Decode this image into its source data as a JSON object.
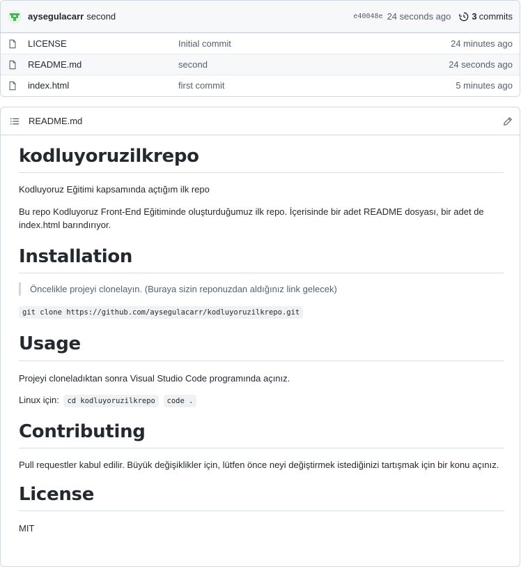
{
  "commit": {
    "author": "aysegulacarr",
    "message": "second",
    "sha": "e40048e",
    "time": "24 seconds ago",
    "count": "3",
    "count_label": "commits"
  },
  "files": [
    {
      "name": "LICENSE",
      "commit": "Initial commit",
      "age": "24 minutes ago"
    },
    {
      "name": "README.md",
      "commit": "second",
      "age": "24 seconds ago"
    },
    {
      "name": "index.html",
      "commit": "first commit",
      "age": "5 minutes ago"
    }
  ],
  "readme": {
    "filename": "README.md",
    "title": "kodluyoruzilkrepo",
    "intro": "Kodluyoruz Eğitimi kapsamında açtığım ilk repo",
    "description": "Bu repo Kodluyoruz Front-End Eğitiminde oluşturduğumuz ilk repo. İçerisinde bir adet README dosyası, bir adet de index.html barındırıyor.",
    "installation": {
      "heading": "Installation",
      "quote": "Öncelikle projeyi clonelayın. (Buraya sizin reponuzdan aldığınız link gelecek)",
      "command": "git clone https://github.com/aysegulacarr/kodluyoruzilkrepo.git"
    },
    "usage": {
      "heading": "Usage",
      "text": "Projeyi cloneladıktan sonra Visual Studio Code programında açınız.",
      "linux_label": "Linux için:",
      "cmd1": "cd kodluyoruzilkrepo",
      "cmd2": "code ."
    },
    "contributing": {
      "heading": "Contributing",
      "text": "Pull requestler kabul edilir. Büyük değişiklikler için, lütfen önce neyi değiştirmek istediğinizi tartışmak için bir konu açınız."
    },
    "license": {
      "heading": "License",
      "text": "MIT"
    }
  },
  "icons": {
    "avatar": "avatar-icon",
    "history": "history-icon",
    "file": "file-icon",
    "list": "list-icon",
    "edit": "pencil-icon"
  },
  "colors": {
    "border": "#d0d7de",
    "muted": "#57606a",
    "header_bg": "#f6f8fa",
    "avatar": "#3fb950"
  }
}
